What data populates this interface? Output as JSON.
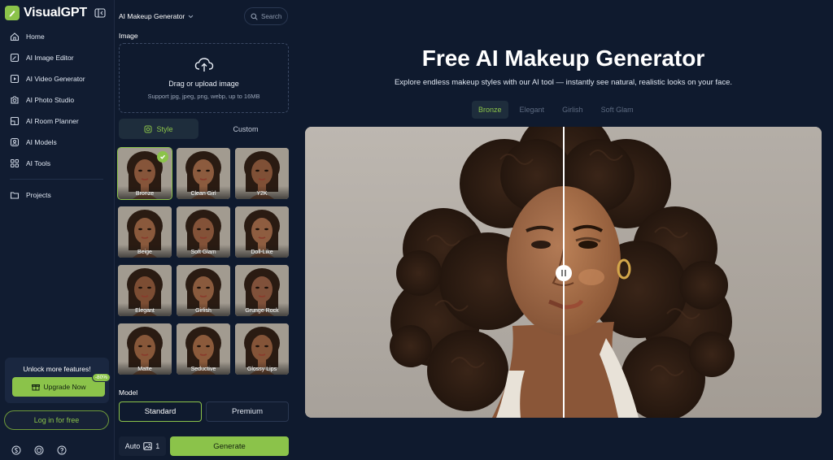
{
  "brand": {
    "name": "VisualGPT",
    "accent": "#8bc34a"
  },
  "sidebar": {
    "items": [
      {
        "label": "Home",
        "icon": "home-icon"
      },
      {
        "label": "AI Image Editor",
        "icon": "image-edit-icon"
      },
      {
        "label": "AI Video Generator",
        "icon": "video-icon"
      },
      {
        "label": "AI Photo Studio",
        "icon": "camera-icon"
      },
      {
        "label": "AI Room Planner",
        "icon": "room-icon"
      },
      {
        "label": "AI Models",
        "icon": "models-icon"
      },
      {
        "label": "AI Tools",
        "icon": "grid-icon"
      }
    ],
    "projects_label": "Projects",
    "upgrade": {
      "title": "Unlock more features!",
      "button": "Upgrade Now",
      "discount": "-80%"
    },
    "login": "Log in for free"
  },
  "panel": {
    "title": "AI Makeup Generator",
    "search_placeholder": "Search",
    "image_label": "Image",
    "upload_title": "Drag or upload image",
    "upload_sub": "Support jpg, jpeg, png, webp, up to 16MB",
    "tabs": {
      "style": "Style",
      "custom": "Custom"
    },
    "styles": [
      "Bronze",
      "Clean Girl",
      "Y2K",
      "Beige",
      "Soft Glam",
      "Doll-Like",
      "Elegant",
      "Girlish",
      "Grunge Rock",
      "Matte",
      "Seductive",
      "Glossy Lips"
    ],
    "selected_style": "Bronze",
    "model_label": "Model",
    "models": {
      "standard": "Standard",
      "premium": "Premium"
    },
    "count": {
      "mode": "Auto",
      "value": "1"
    },
    "generate": "Generate"
  },
  "main": {
    "title": "Free AI Makeup Generator",
    "subtitle": "Explore endless makeup styles with our AI tool — instantly see natural, realistic looks on your face.",
    "style_tabs": [
      "Bronze",
      "Elegant",
      "Girlish",
      "Soft Glam"
    ],
    "active_tab": "Bronze"
  }
}
